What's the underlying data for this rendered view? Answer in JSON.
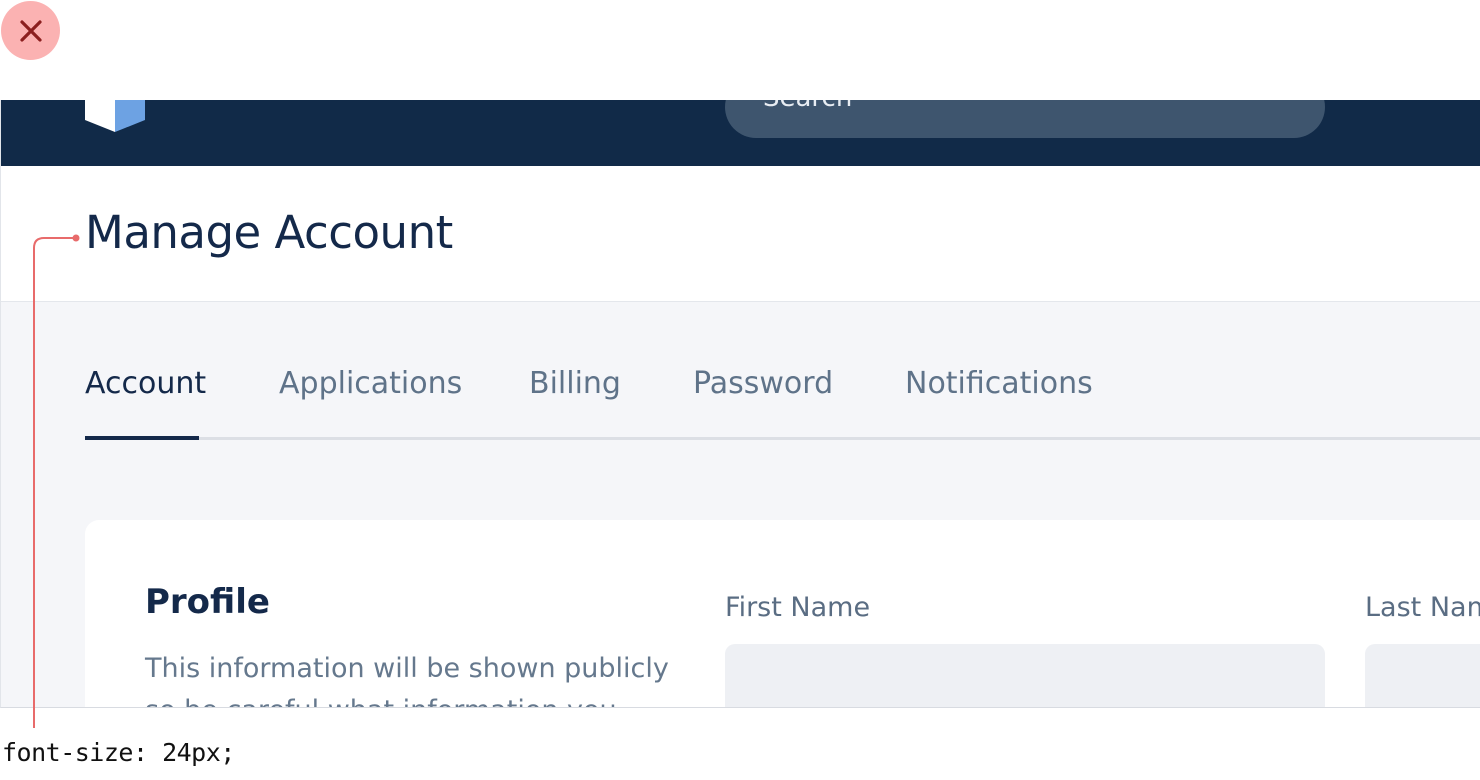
{
  "overlay": {
    "close_icon": "close-icon",
    "close_color": "#fbb2b2",
    "css_note": "font-size: 24px;"
  },
  "topbar": {
    "background": "#112a48",
    "logo_icon": "shield-logo-icon",
    "search_text": "Search"
  },
  "header": {
    "title": "Manage Account"
  },
  "tabs": [
    {
      "label": "Account",
      "active": true
    },
    {
      "label": "Applications",
      "active": false
    },
    {
      "label": "Billing",
      "active": false
    },
    {
      "label": "Password",
      "active": false
    },
    {
      "label": "Notifications",
      "active": false
    }
  ],
  "profile": {
    "title": "Profile",
    "description": "This information will be shown publicly so be careful what information you provide.",
    "fields": [
      {
        "label": "First Name",
        "value": ""
      },
      {
        "label": "Last Name",
        "value": ""
      }
    ]
  }
}
